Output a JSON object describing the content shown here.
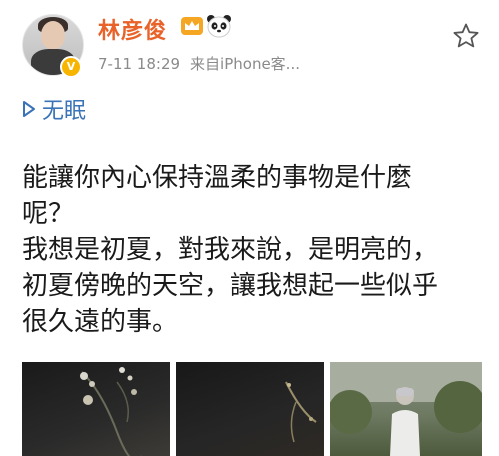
{
  "post": {
    "username": "林彦俊",
    "timestamp": "7-11 18:29",
    "source": "来自iPhone客...",
    "verified": true,
    "accent_color": "#e8622a",
    "link_text": "无眠",
    "link_color": "#3a73b8",
    "content_lines": [
      "能讓你內心保持溫柔的事物是什麼",
      "呢？",
      "我想是初夏，對我來說，是明亮的，",
      "初夏傍晚的天空，讓我想起一些似乎",
      "很久遠的事。"
    ],
    "icons": [
      "crown-icon",
      "panda-icon",
      "star-icon",
      "play-icon",
      "verified-badge-icon"
    ],
    "photos": [
      "photo-dark-flowers",
      "photo-dark-branch",
      "photo-man-in-white"
    ]
  }
}
